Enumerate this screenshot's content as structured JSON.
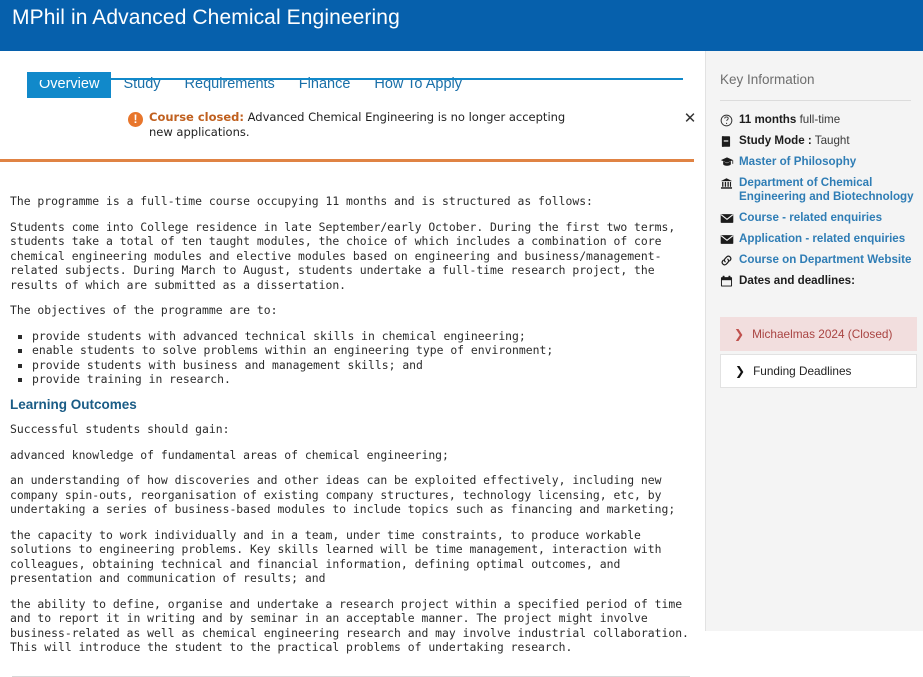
{
  "header": {
    "title": "MPhil in Advanced Chemical Engineering",
    "bg_color": "#0660AC"
  },
  "tabs": {
    "active_color": "#1189CA",
    "items": [
      {
        "label": "Overview",
        "active": true
      },
      {
        "label": "Study",
        "active": false
      },
      {
        "label": "Requirements",
        "active": false
      },
      {
        "label": "Finance",
        "active": false
      },
      {
        "label": "How To Apply",
        "active": false
      }
    ]
  },
  "alert": {
    "icon": "exclamation-circle-icon",
    "strong_label": "Course closed:",
    "message": "Advanced Chemical Engineering is no longer accepting new applications.",
    "close_icon": "close-icon",
    "accent_color": "#E8762C"
  },
  "content": {
    "intro": "The programme is a full-time course occupying 11 months and is structured as follows:",
    "structure": "Students come into College residence in late September/early October. During the first two terms, students take a total of ten taught modules, the choice of which includes a combination of core chemical engineering modules and elective modules based on engineering and business/management-related subjects. During March to August, students undertake a full-time research project, the results of which are submitted as a dissertation.",
    "objectives_intro": "The objectives of the programme are to:",
    "objectives": [
      "provide students with advanced technical skills in chemical engineering;",
      "enable students to solve problems within an engineering type of environment;",
      "provide students with business and management skills; and",
      "provide training in research."
    ],
    "learning_outcomes_heading": "Learning Outcomes",
    "learning_intro": "Successful students should gain:",
    "learning_points": [
      "advanced knowledge of fundamental areas of chemical engineering;",
      "an understanding of how discoveries and other ideas can be exploited effectively, including new company spin-outs, reorganisation of existing company structures, technology licensing, etc, by undertaking a series of business-based modules to include topics such as financing and marketing;",
      "the capacity to work individually and in a team, under time constraints, to produce workable solutions to engineering problems. Key skills learned will be time management, interaction with colleagues, obtaining technical and financial information, defining optimal outcomes, and presentation and communication of results; and",
      "the ability to define, organise and undertake a research project within a specified period of time and to report it in writing and by seminar in an acceptable manner. The project might involve business-related as well as chemical engineering research and may involve industrial collaboration. This will introduce the student to the practical problems of undertaking research."
    ]
  },
  "sidebar": {
    "title": "Key Information",
    "items": [
      {
        "icon": "clock-icon",
        "bold_text": "11 months",
        "normal_text": " full-time",
        "link": false
      },
      {
        "icon": "book-icon",
        "bold_text": "Study Mode :",
        "normal_text": " Taught",
        "link": false
      },
      {
        "icon": "graduation-cap-icon",
        "bold_text": "Master of Philosophy",
        "normal_text": "",
        "link": true
      },
      {
        "icon": "institution-icon",
        "bold_text": "Department of Chemical Engineering and Biotechnology",
        "normal_text": "",
        "link": true
      },
      {
        "icon": "envelope-icon",
        "bold_text": "Course - related enquiries",
        "normal_text": "",
        "link": true
      },
      {
        "icon": "envelope-icon",
        "bold_text": "Application - related enquiries",
        "normal_text": "",
        "link": true
      },
      {
        "icon": "link-icon",
        "bold_text": "Course on Department Website",
        "normal_text": "",
        "link": true
      },
      {
        "icon": "calendar-icon",
        "bold_text": "Dates and deadlines:",
        "normal_text": "",
        "link": false
      }
    ],
    "accordion": [
      {
        "label": "Michaelmas 2024 (Closed)",
        "state": "closed",
        "chevron": "chevron-right-icon"
      },
      {
        "label": "Funding Deadlines",
        "state": "open",
        "chevron": "chevron-right-icon"
      }
    ],
    "link_color": "#2F7DB5",
    "closed_bg": "#F2DEDE",
    "closed_text": "#A94442"
  }
}
